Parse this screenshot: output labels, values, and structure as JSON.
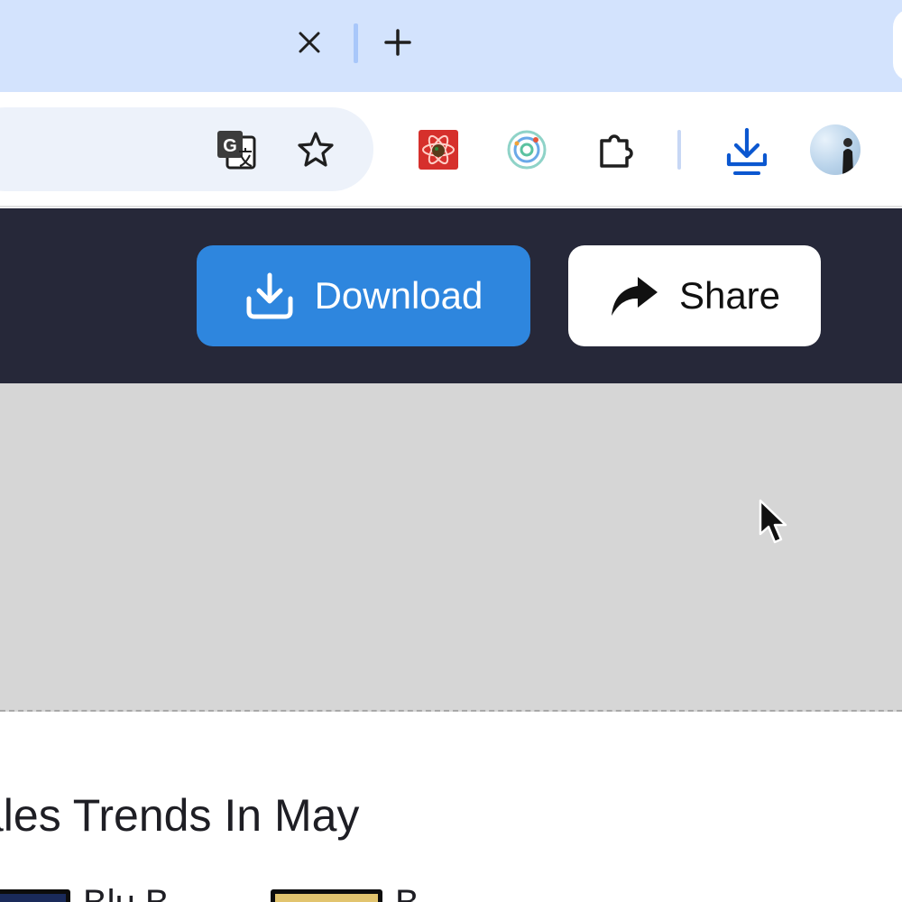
{
  "browser": {
    "tab_strip": {
      "close_icon": "close-icon",
      "new_tab_icon": "plus-icon",
      "background": "#d3e3fd"
    },
    "toolbar": {
      "icons": [
        "translate-icon",
        "star-icon",
        "react-devtools-extension-icon",
        "circle-extension-icon",
        "puzzle-icon",
        "download-icon",
        "avatar"
      ],
      "download_icon_color": "#0b57d0"
    }
  },
  "header": {
    "download_label": "Download",
    "share_label": "Share",
    "download_color": "#2e86de",
    "background": "#262839"
  },
  "content": {
    "section_title": "ales Trends In May",
    "items": [
      {
        "label": "Blu B"
      },
      {
        "label": "B"
      }
    ]
  }
}
